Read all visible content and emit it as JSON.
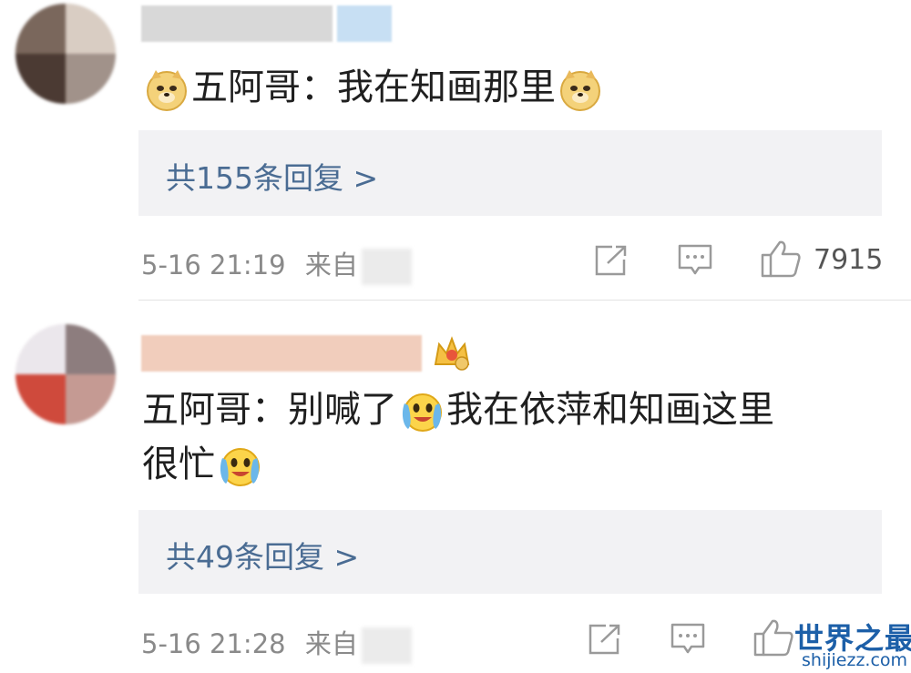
{
  "comments": [
    {
      "text_before_emoji": "五阿哥：我在知画那里",
      "reply_link": "共155条回复 >",
      "timestamp": "5-16 21:19",
      "source_label": "来自",
      "likes": "7915",
      "emoji": "doge-face-icon"
    },
    {
      "text_line1_a": "五阿哥：别喊了",
      "text_line1_b": "我在依萍和知画这里",
      "text_line2": "很忙",
      "reply_link": "共49条回复 >",
      "timestamp": "5-16 21:28",
      "source_label": "来自",
      "emoji": "crying-laughing-face-icon",
      "badge": "crown-badge-icon"
    }
  ],
  "watermark": {
    "title": "世界之最",
    "domain": "shijiezz.com"
  },
  "colors": {
    "link": "#4a6c93",
    "meta": "#8a8a8a",
    "reply_bg": "#f2f2f4",
    "watermark": "#1c5fa8"
  }
}
